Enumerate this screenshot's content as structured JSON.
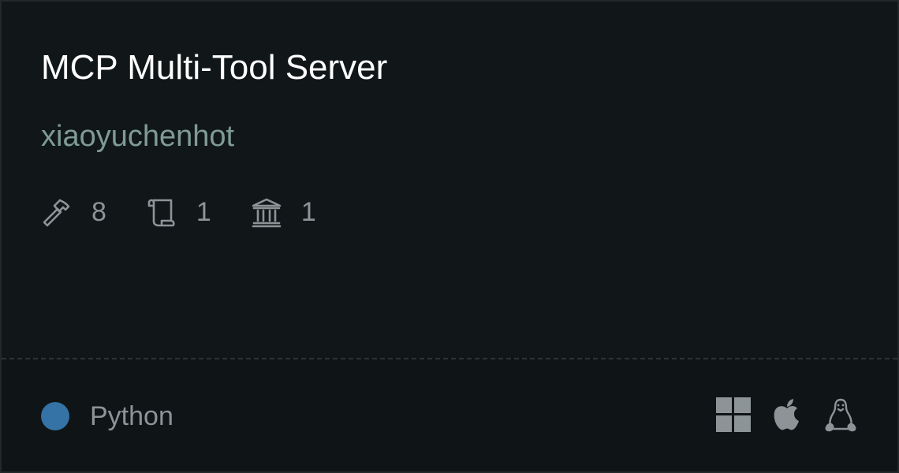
{
  "card": {
    "title": "MCP Multi-Tool Server",
    "author": "xiaoyuchenhot",
    "stats": {
      "tools": {
        "icon": "hammer-icon",
        "count": "8"
      },
      "prompts": {
        "icon": "scroll-icon",
        "count": "1"
      },
      "resources": {
        "icon": "bank-icon",
        "count": "1"
      }
    },
    "language": {
      "name": "Python",
      "color": "#3572a5"
    },
    "platforms": [
      "windows-icon",
      "apple-icon",
      "linux-icon"
    ]
  }
}
